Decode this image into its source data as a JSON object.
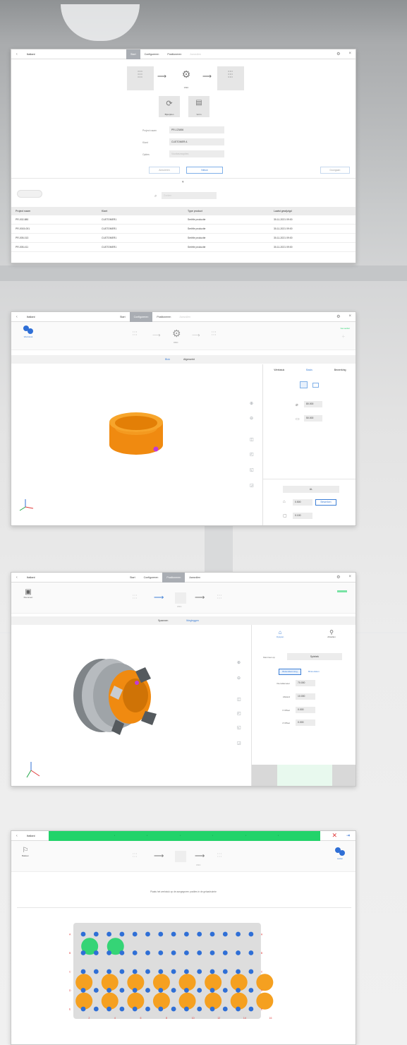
{
  "brand": {
    "blue": "#2f6fd6",
    "orange": "#f5a020",
    "green": "#22d36a",
    "purple": "#c03ad8",
    "tab_active": "#a9adb3"
  },
  "panel1": {
    "back_icon": "chevron-left-icon",
    "label": "Italiani",
    "tabs": [
      "Start",
      "Configureren",
      "Positioneren",
      "Aanvullen"
    ],
    "steps": [
      {
        "label": "CNC"
      },
      {
        "label": "CNC"
      }
    ],
    "tools": [
      {
        "label": "Bijsnijden",
        "icon": "crop-icon"
      },
      {
        "label": "Vorm",
        "icon": "table-icon"
      }
    ],
    "fields": [
      {
        "label": "Project naam",
        "value": "PR-123456"
      },
      {
        "label": "Klant",
        "value": "CUSTOMER A"
      },
      {
        "label": "Opties",
        "value": "Voorkeursopties"
      }
    ],
    "buttons": {
      "secondary": "Annuleren",
      "primary": "Nieuw",
      "right": "Doorgaan"
    },
    "search_label": "Zoeken",
    "columns": [
      "Project naam",
      "Klant",
      "Type product",
      "Laatst gewijzigd"
    ],
    "rows": [
      [
        "PR-002-880",
        "CUSTOMER1",
        "Seriële productie",
        "30-11-2021 09:00"
      ],
      [
        "PR-0015-001",
        "CUSTOMER1",
        "Seriële productie",
        "30-11-2021 09:00"
      ],
      [
        "PR-005-013",
        "CUSTOMER1",
        "Seriële productie",
        "30-11-2021 09:00"
      ],
      [
        "PR-005-411",
        "CUSTOMER1",
        "Seriële productie",
        "30-11-2021 09:00"
      ]
    ]
  },
  "panel2": {
    "label": "Italiani",
    "tabs": [
      "Start",
      "Configureren",
      "Positioneren",
      "Aanvullen"
    ],
    "left_tool": "Werkstuk",
    "steps_label": "CNC",
    "right_note": "Ga verder",
    "subtabs": [
      "Blok",
      "Afgewerkt"
    ],
    "right_tabs": [
      "Werkstuk",
      "Basis",
      "Bewerking"
    ],
    "dims": [
      {
        "icon": "diameter-icon",
        "value": "80.000"
      },
      {
        "icon": "height-icon",
        "value": "50.000"
      }
    ],
    "material_btn": "AL",
    "stock": [
      {
        "value": "0.500",
        "action": "Bewerken"
      },
      {
        "value": "0.100"
      }
    ]
  },
  "panel3": {
    "label": "Italiani",
    "tabs": [
      "Start",
      "Configureren",
      "Positioneren",
      "Aanvullen"
    ],
    "left_tool": "Klemmen",
    "steps_label": "CNC",
    "subtabs": [
      "Spannen",
      "Wegleggen"
    ],
    "actions": [
      "Opspan",
      "Afstellen"
    ],
    "mode_label": "Klemmen op",
    "mode_value": "Spiebek",
    "toggle": [
      "Buitenklemming",
      "Binnenklem"
    ],
    "params": [
      {
        "label": "Klemdiameter",
        "value": "70.000"
      },
      {
        "label": "Afstand",
        "value": "10.000"
      },
      {
        "label": "X Offset",
        "value": "0.000"
      },
      {
        "label": "Z Offset",
        "value": "0.000"
      }
    ]
  },
  "panel4": {
    "label": "Italiani",
    "left_tool": "Bakken",
    "right_tool": "Laden",
    "steps_label": "CNC",
    "message": "Plaats het werkstuk op de aangegeven posities in de gelaadruimte",
    "column_numbers": [
      "2",
      "4",
      "6",
      "8",
      "10",
      "12",
      "14",
      "16"
    ],
    "row_letters": [
      "A",
      "B",
      "C",
      "D",
      "E"
    ],
    "grid": {
      "rows": 5,
      "cols": 14,
      "green_count": 2,
      "orange_rows": 2,
      "orange_count_per_row": 8
    }
  }
}
